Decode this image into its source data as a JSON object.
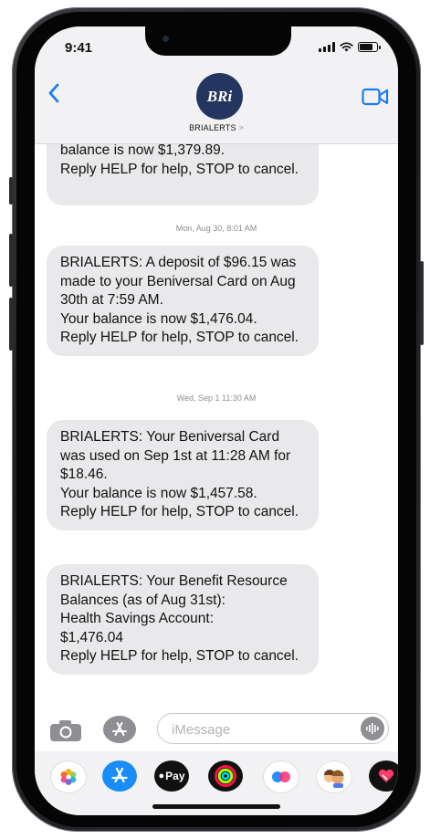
{
  "status": {
    "time": "9:41",
    "battery_level": 0.8
  },
  "header": {
    "contact_name": "BRIALERTS",
    "chevron": ">",
    "avatar_text": "BRi"
  },
  "messages": [
    {
      "text": " balance is now $1,379.89.\nReply HELP for help, STOP to cancel."
    },
    {
      "text": "BRIALERTS: A deposit of $96.15 was made to your Beniversal Card on Aug 30th at 7:59 AM.\nYour balance is now $1,476.04.\nReply HELP for help, STOP to cancel."
    },
    {
      "text": "BRIALERTS: Your Beniversal Card was used on Sep 1st at 11:28 AM for $18.46.\nYour balance is now $1,457.58.\nReply HELP for help, STOP to cancel."
    },
    {
      "text": "BRIALERTS: Your Benefit Resource Balances (as of Aug 31st):\nHealth Savings Account:\n$1,476.04\nReply HELP for help, STOP to cancel."
    }
  ],
  "timestamps": [
    {
      "day": "Mon, Aug 30,",
      "time": " 8:01 AM"
    },
    {
      "day": "Wed, Sep 1",
      "time": " 11:30 AM"
    }
  ],
  "composer": {
    "placeholder": "iMessage"
  },
  "app_tray": [
    {
      "icon": "photos-icon"
    },
    {
      "icon": "app-store-icon"
    },
    {
      "icon": "apple-pay-icon",
      "label": "Pay"
    },
    {
      "icon": "activity-icon"
    },
    {
      "icon": "digital-touch-icon"
    },
    {
      "icon": "memoji-icon"
    },
    {
      "icon": "hearts-sticker-icon"
    }
  ],
  "colors": {
    "accent": "#1a7cf5",
    "bubble": "#e9e9eb",
    "avatar": "#24355f"
  }
}
